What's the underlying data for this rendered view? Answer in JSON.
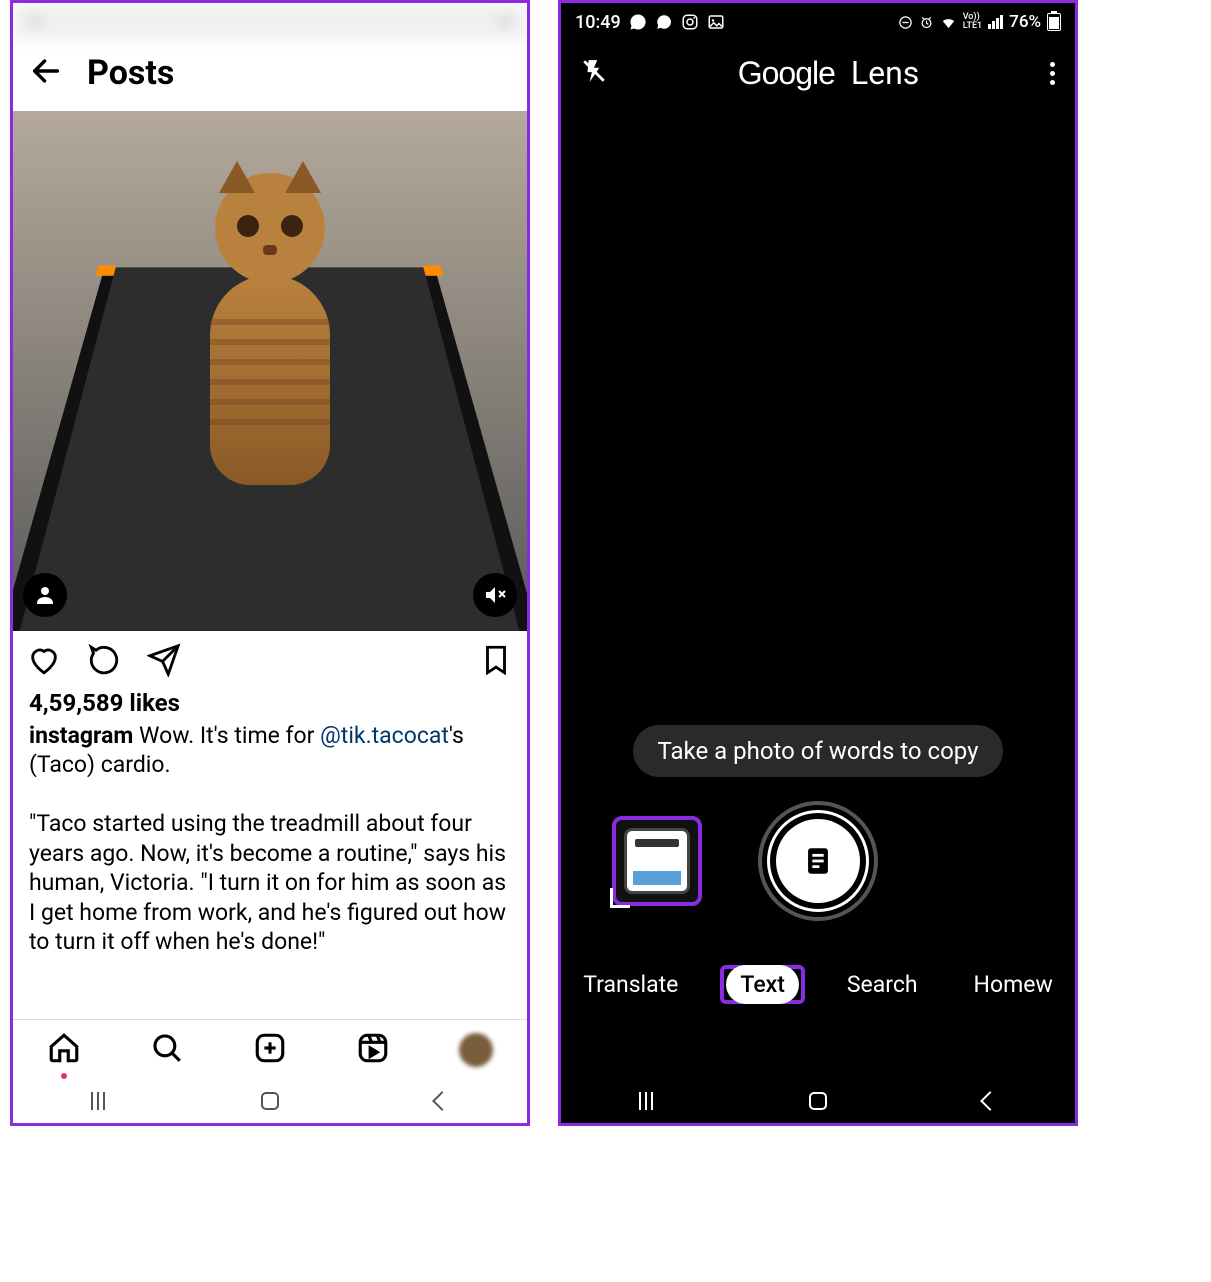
{
  "left": {
    "header_title": "Posts",
    "likes_text": "4,59,589 likes",
    "caption_user": "instagram",
    "caption_pre": " Wow. It's time for ",
    "caption_mention": "@tik.tacocat",
    "caption_post": "'s (Taco) cardio.",
    "caption_para2": "\"Taco started using the treadmill about four years ago. Now, it's become a routine,\" says his human, Victoria. \"I turn it on for him as soon as I get home from work, and he's figured out how to turn it off when he's done!\""
  },
  "right": {
    "status_time": "10:49",
    "battery_text": "76%",
    "net_label": "LTE1",
    "app_name_1": "Google",
    "app_name_2": "Lens",
    "hint": "Take a photo of words to copy",
    "modes": {
      "translate": "Translate",
      "text": "Text",
      "search": "Search",
      "homework": "Homew"
    }
  }
}
